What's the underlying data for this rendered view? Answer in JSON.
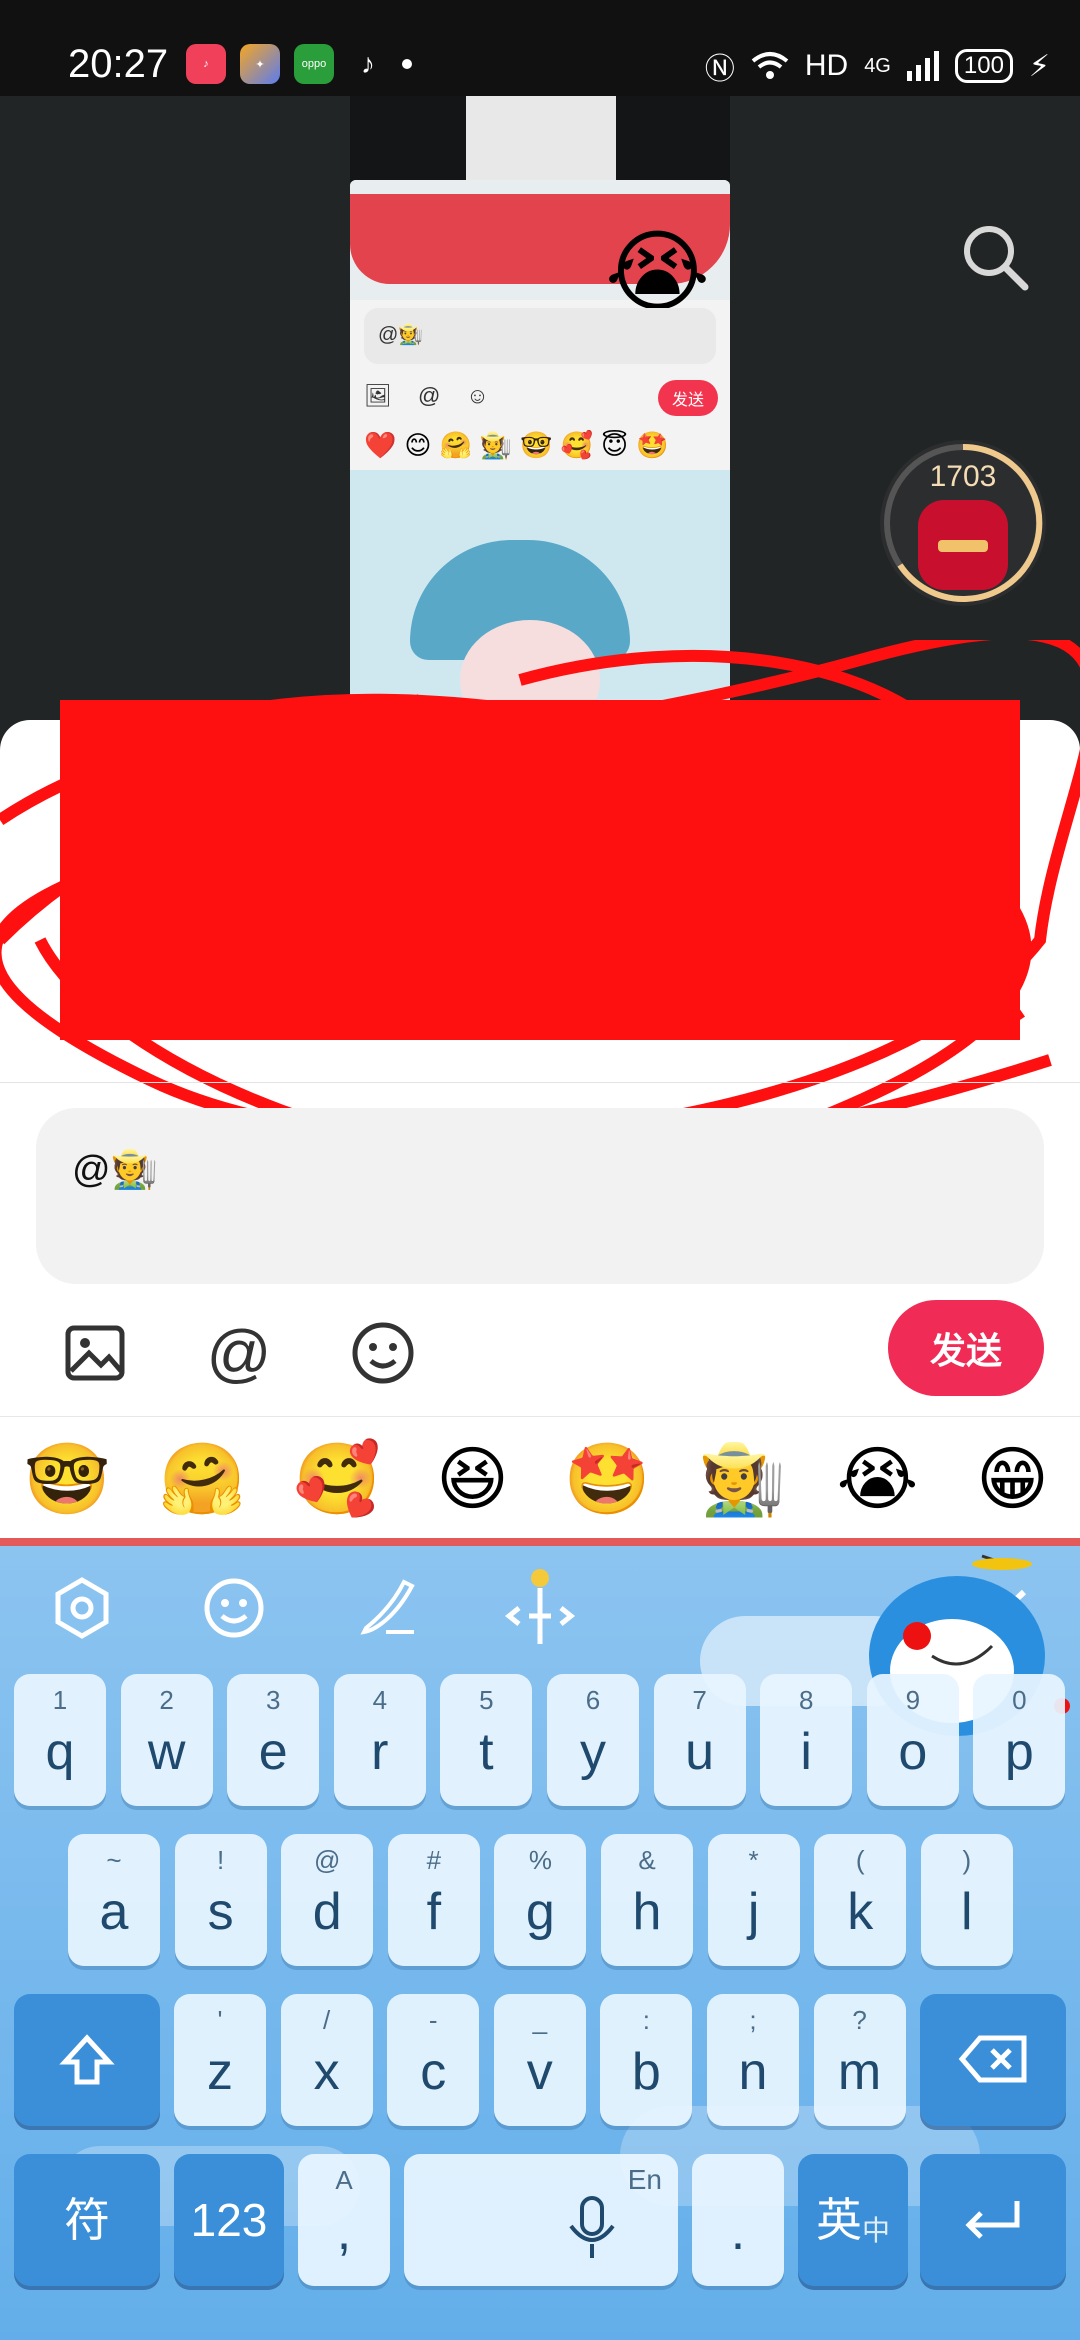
{
  "status_bar": {
    "time": "20:27",
    "app_icons": [
      "music-app-icon",
      "media-app-icon",
      "oppo-app-icon",
      "tiktok-icon"
    ],
    "network_label": "HD",
    "signal_label": "4G",
    "battery": "100"
  },
  "video": {
    "reward_count": "1703"
  },
  "preview": {
    "input_text": "@🧑‍🌾",
    "send_label": "发送",
    "emojis": [
      "❤️",
      "😊",
      "🤗",
      "🧑‍🌾",
      "🤓",
      "🥰",
      "😇",
      "🤩"
    ]
  },
  "comment": {
    "input_text": "@🧑‍🌾"
  },
  "toolbar": {
    "image_icon": "image-icon",
    "at_label": "@",
    "emoji_icon": "smiley-icon",
    "send_label": "发送"
  },
  "emoji_row": [
    "🤓",
    "🤗",
    "🥰",
    "😆",
    "🤩",
    "🧑‍🌾",
    "😭",
    "😁"
  ],
  "keyboard": {
    "tools": [
      "settings-hexagon-icon",
      "smiley-icon",
      "handwriting-pen-icon",
      "cursor-move-icon",
      "check-icon"
    ],
    "row1": [
      {
        "sub": "1",
        "main": "q"
      },
      {
        "sub": "2",
        "main": "w"
      },
      {
        "sub": "3",
        "main": "e"
      },
      {
        "sub": "4",
        "main": "r"
      },
      {
        "sub": "5",
        "main": "t"
      },
      {
        "sub": "6",
        "main": "y"
      },
      {
        "sub": "7",
        "main": "u"
      },
      {
        "sub": "8",
        "main": "i"
      },
      {
        "sub": "9",
        "main": "o"
      },
      {
        "sub": "0",
        "main": "p"
      }
    ],
    "row2": [
      {
        "sub": "~",
        "main": "a"
      },
      {
        "sub": "!",
        "main": "s"
      },
      {
        "sub": "@",
        "main": "d"
      },
      {
        "sub": "#",
        "main": "f"
      },
      {
        "sub": "%",
        "main": "g"
      },
      {
        "sub": "&",
        "main": "h"
      },
      {
        "sub": "*",
        "main": "j"
      },
      {
        "sub": "(",
        "main": "k"
      },
      {
        "sub": ")",
        "main": "l"
      }
    ],
    "row3": [
      {
        "sub": "'",
        "main": "z"
      },
      {
        "sub": "/",
        "main": "x"
      },
      {
        "sub": "-",
        "main": "c"
      },
      {
        "sub": "_",
        "main": "v"
      },
      {
        "sub": ":",
        "main": "b"
      },
      {
        "sub": ";",
        "main": "n"
      },
      {
        "sub": "?",
        "main": "m"
      }
    ],
    "symbols_label": "符",
    "numbers_label": "123",
    "comma_sub": "A",
    "comma_label": ",",
    "space_sub": "En",
    "period_label": ".",
    "lang_label": "英",
    "lang_sub": "中"
  }
}
